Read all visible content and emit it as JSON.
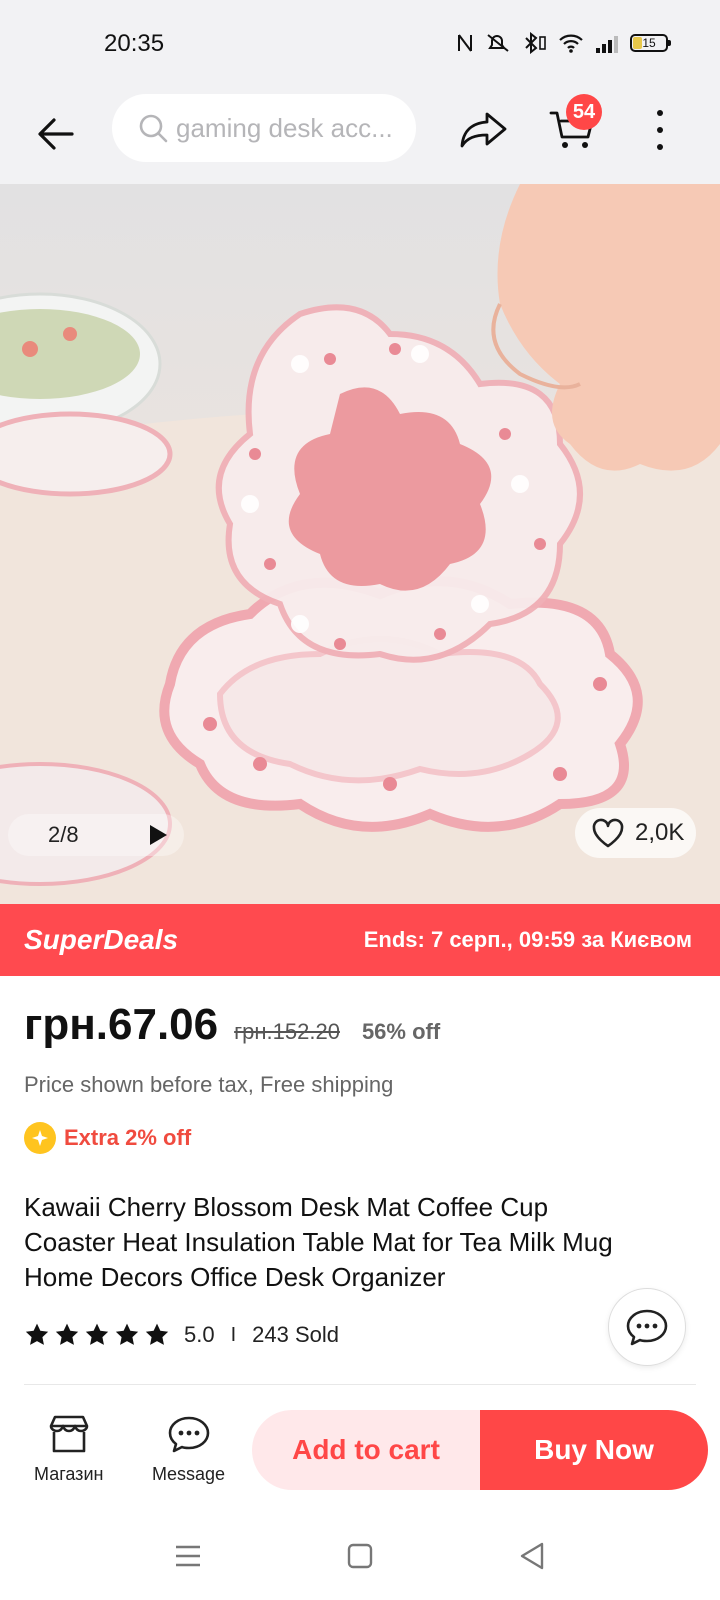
{
  "status_bar": {
    "time": "20:35",
    "battery": "15"
  },
  "header": {
    "search_placeholder": "gaming desk acc...",
    "cart_count": "54"
  },
  "gallery": {
    "counter": "2/8",
    "wishlist_count": "2,0K"
  },
  "deal": {
    "brand": "SuperDeals",
    "ends": "Ends: 7 серп., 09:59 за Києвом"
  },
  "price": {
    "current": "грн.67.06",
    "original": "грн.152.20",
    "discount": "56% off",
    "tax_note": "Price shown before tax, Free shipping",
    "extra": "Extra 2% off"
  },
  "product": {
    "title": "Kawaii Cherry Blossom Desk Mat Coffee Cup Coaster Heat Insulation Table Mat for Tea Milk Mug Home Decors Office Desk Organizer",
    "rating": "5.0",
    "rating_separator": "I",
    "sold": "243 Sold",
    "stars": 5
  },
  "bottom_bar": {
    "store_label": "Магазин",
    "message_label": "Message",
    "add_to_cart": "Add to cart",
    "buy_now": "Buy Now"
  },
  "colors": {
    "accent": "#ff4747",
    "deal_bar": "#ff4a4f",
    "add_cart_bg": "#ffe8ea",
    "coin": "#ffc41f"
  },
  "icons": {
    "back": "back-arrow-icon",
    "search": "search-icon",
    "share": "share-icon",
    "cart": "cart-icon",
    "more": "more-vertical-icon",
    "play": "play-icon",
    "wishlist": "heart-icon",
    "store": "store-icon",
    "message": "chat-icon",
    "star": "star-icon"
  }
}
